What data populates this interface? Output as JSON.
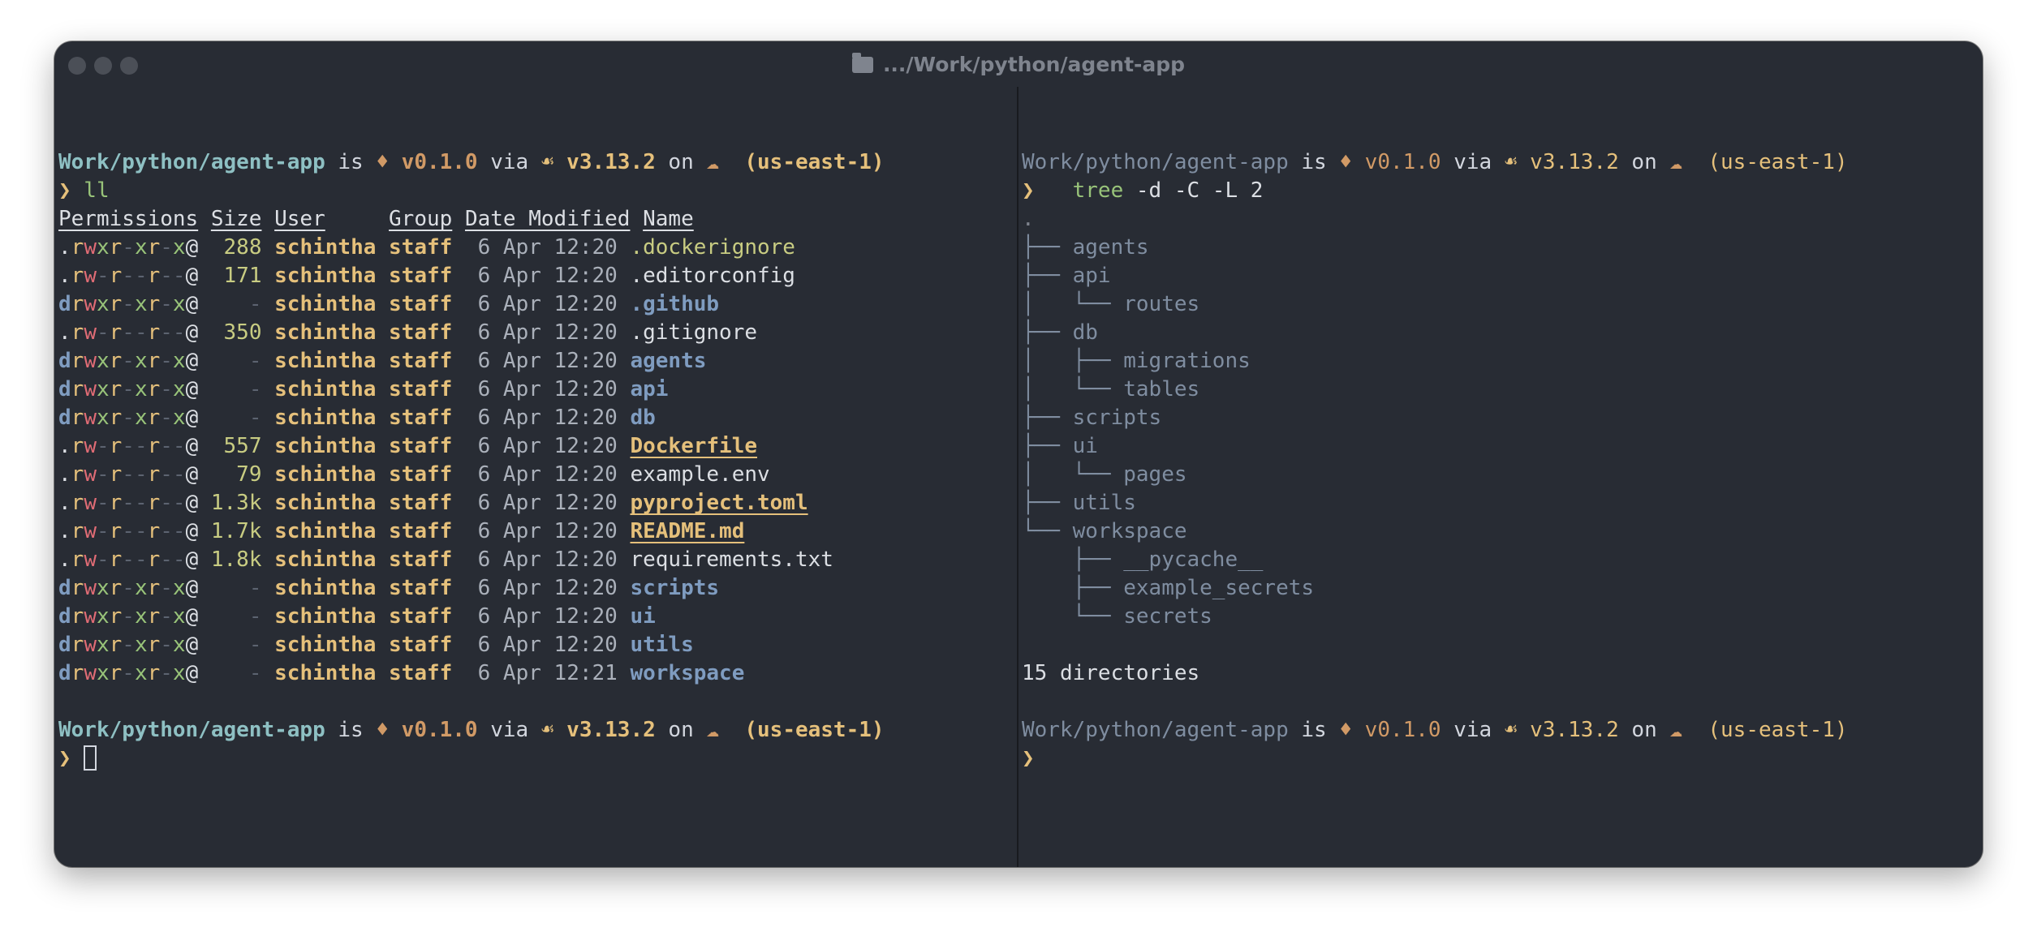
{
  "window": {
    "title": ".../Work/python/agent-app",
    "folder_icon": "folder-icon"
  },
  "prompt": {
    "path": "Work/python/agent-app",
    "is": "is",
    "pkg_glyph": "♦",
    "version": "v0.1.0",
    "via": "via",
    "python_glyph": "☙",
    "python_version": "v3.13.2",
    "on": "on",
    "cloud_glyph": "☁",
    "region": "(us-east-1)",
    "chevron": "❯"
  },
  "left": {
    "command": "ll",
    "headers": [
      "Permissions",
      "Size",
      "User",
      "Group",
      "Date Modified",
      "Name"
    ],
    "rows": [
      {
        "perm": ".rwxr-xr-x@",
        "size": "288",
        "user": "schintha",
        "group": "staff",
        "date": "6 Apr 12:20",
        "name": ".dockerignore",
        "kind": "dotfile"
      },
      {
        "perm": ".rw-r--r--@",
        "size": "171",
        "user": "schintha",
        "group": "staff",
        "date": "6 Apr 12:20",
        "name": ".editorconfig",
        "kind": "file"
      },
      {
        "perm": "drwxr-xr-x@",
        "size": "-",
        "user": "schintha",
        "group": "staff",
        "date": "6 Apr 12:20",
        "name": ".github",
        "kind": "dir"
      },
      {
        "perm": ".rw-r--r--@",
        "size": "350",
        "user": "schintha",
        "group": "staff",
        "date": "6 Apr 12:20",
        "name": ".gitignore",
        "kind": "file"
      },
      {
        "perm": "drwxr-xr-x@",
        "size": "-",
        "user": "schintha",
        "group": "staff",
        "date": "6 Apr 12:20",
        "name": "agents",
        "kind": "dir"
      },
      {
        "perm": "drwxr-xr-x@",
        "size": "-",
        "user": "schintha",
        "group": "staff",
        "date": "6 Apr 12:20",
        "name": "api",
        "kind": "dir"
      },
      {
        "perm": "drwxr-xr-x@",
        "size": "-",
        "user": "schintha",
        "group": "staff",
        "date": "6 Apr 12:20",
        "name": "db",
        "kind": "dir"
      },
      {
        "perm": ".rw-r--r--@",
        "size": "557",
        "user": "schintha",
        "group": "staff",
        "date": "6 Apr 12:20",
        "name": "Dockerfile",
        "kind": "special"
      },
      {
        "perm": ".rw-r--r--@",
        "size": "79",
        "user": "schintha",
        "group": "staff",
        "date": "6 Apr 12:20",
        "name": "example.env",
        "kind": "file"
      },
      {
        "perm": ".rw-r--r--@",
        "size": "1.3k",
        "user": "schintha",
        "group": "staff",
        "date": "6 Apr 12:20",
        "name": "pyproject.toml",
        "kind": "special"
      },
      {
        "perm": ".rw-r--r--@",
        "size": "1.7k",
        "user": "schintha",
        "group": "staff",
        "date": "6 Apr 12:20",
        "name": "README.md",
        "kind": "special"
      },
      {
        "perm": ".rw-r--r--@",
        "size": "1.8k",
        "user": "schintha",
        "group": "staff",
        "date": "6 Apr 12:20",
        "name": "requirements.txt",
        "kind": "file"
      },
      {
        "perm": "drwxr-xr-x@",
        "size": "-",
        "user": "schintha",
        "group": "staff",
        "date": "6 Apr 12:20",
        "name": "scripts",
        "kind": "dir"
      },
      {
        "perm": "drwxr-xr-x@",
        "size": "-",
        "user": "schintha",
        "group": "staff",
        "date": "6 Apr 12:20",
        "name": "ui",
        "kind": "dir"
      },
      {
        "perm": "drwxr-xr-x@",
        "size": "-",
        "user": "schintha",
        "group": "staff",
        "date": "6 Apr 12:20",
        "name": "utils",
        "kind": "dir"
      },
      {
        "perm": "drwxr-xr-x@",
        "size": "-",
        "user": "schintha",
        "group": "staff",
        "date": "6 Apr 12:21",
        "name": "workspace",
        "kind": "dir"
      }
    ]
  },
  "right": {
    "command_name": "tree",
    "command_args": " -d -C -L 2",
    "root": ".",
    "tree": [
      {
        "prefix": "├── ",
        "name": "agents"
      },
      {
        "prefix": "├── ",
        "name": "api"
      },
      {
        "prefix": "│   └── ",
        "name": "routes"
      },
      {
        "prefix": "├── ",
        "name": "db"
      },
      {
        "prefix": "│   ├── ",
        "name": "migrations"
      },
      {
        "prefix": "│   └── ",
        "name": "tables"
      },
      {
        "prefix": "├── ",
        "name": "scripts"
      },
      {
        "prefix": "├── ",
        "name": "ui"
      },
      {
        "prefix": "│   └── ",
        "name": "pages"
      },
      {
        "prefix": "├── ",
        "name": "utils"
      },
      {
        "prefix": "└── ",
        "name": "workspace"
      },
      {
        "prefix": "    ├── ",
        "name": "__pycache__"
      },
      {
        "prefix": "    ├── ",
        "name": "example_secrets"
      },
      {
        "prefix": "    └── ",
        "name": "secrets"
      }
    ],
    "summary": "15 directories"
  }
}
